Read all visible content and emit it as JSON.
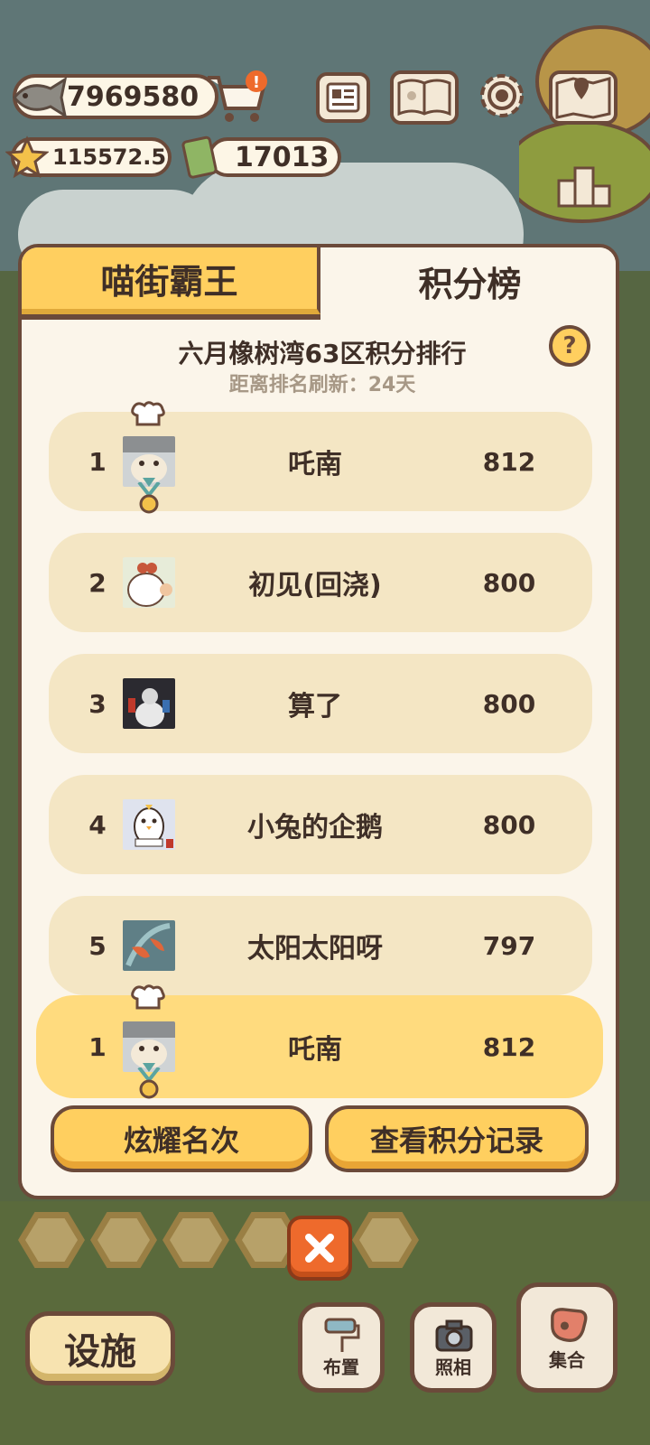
{
  "hud": {
    "fish_count": "7969580",
    "star_value": "115572.5",
    "ticket_count": "17013"
  },
  "panel": {
    "tab_active": "喵街霸王",
    "tab_inactive": "积分榜",
    "title": "六月橡树湾63区积分排行",
    "subtitle": "距离排名刷新：24天",
    "help_label": "?",
    "rows": [
      {
        "rank": "1",
        "name": "吒南",
        "score": "812"
      },
      {
        "rank": "2",
        "name": "初见(回浇)",
        "score": "800"
      },
      {
        "rank": "3",
        "name": "算了",
        "score": "800"
      },
      {
        "rank": "4",
        "name": "小兔的企鹅",
        "score": "800"
      },
      {
        "rank": "5",
        "name": "太阳太阳呀",
        "score": "797"
      }
    ],
    "self_row": {
      "rank": "1",
      "name": "吒南",
      "score": "812"
    },
    "show_off_button": "炫耀名次",
    "view_records_button": "查看积分记录"
  },
  "bottom": {
    "facility_button": "设施",
    "layout_button": "布置",
    "photo_button": "照相",
    "gather_button": "集合"
  },
  "colors": {
    "accent_yellow": "#ffcf5f",
    "row_bg": "#f4e6c4",
    "outline_brown": "#6b4a3a",
    "close_orange": "#ee6a2c"
  }
}
